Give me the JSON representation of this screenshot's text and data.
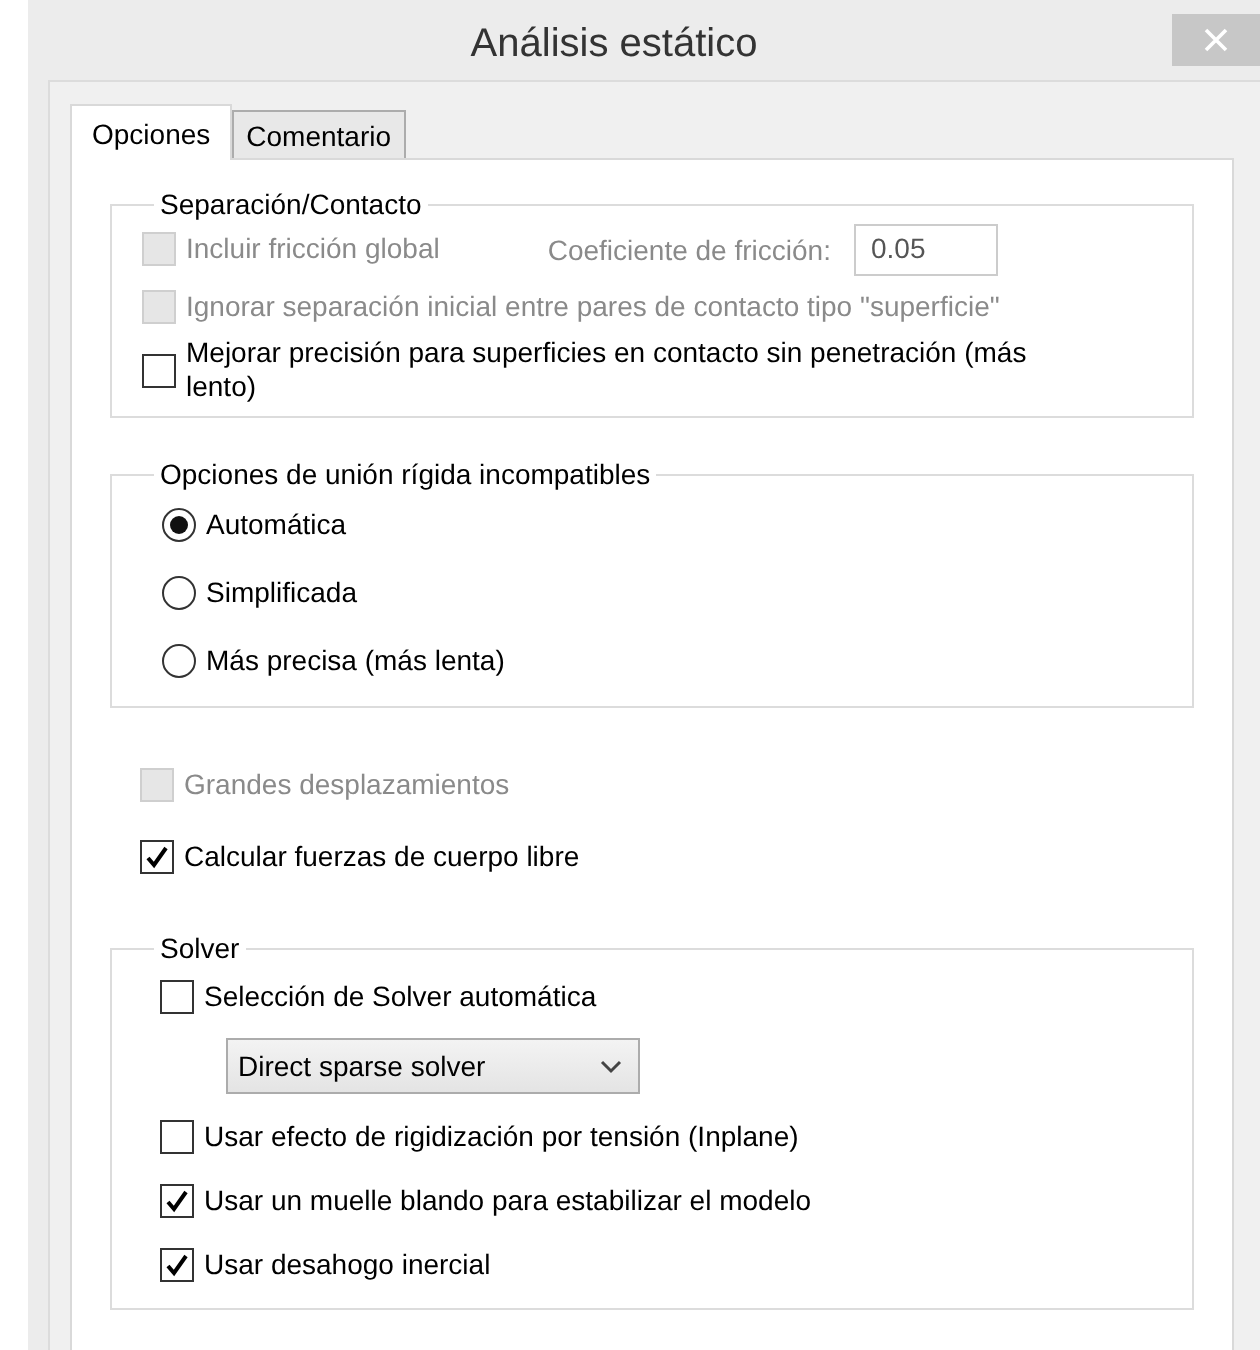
{
  "window": {
    "title": "Análisis estático"
  },
  "tabs": [
    {
      "label": "Opciones",
      "selected": true
    },
    {
      "label": "Comentario",
      "selected": false
    }
  ],
  "sections": [
    {
      "kind": "group",
      "legend": "Separación/Contacto",
      "items": [
        {
          "kind": "checkbox",
          "label": "Incluir fricción global",
          "checked": false,
          "disabled": true,
          "field": {
            "label": "Coeficiente de fricción:",
            "value": "0.05",
            "disabled": true
          }
        },
        {
          "kind": "checkbox",
          "label": "Ignorar separación inicial entre pares de contacto tipo \"superficie\"",
          "checked": false,
          "disabled": true
        },
        {
          "kind": "checkbox",
          "label": "Mejorar precisión para superficies en contacto sin penetración (más lento)",
          "checked": false,
          "disabled": false
        }
      ]
    },
    {
      "kind": "group",
      "legend": "Opciones de unión rígida incompatibles",
      "items": [
        {
          "kind": "radio",
          "label": "Automática",
          "selected": true
        },
        {
          "kind": "radio",
          "label": "Simplificada",
          "selected": false
        },
        {
          "kind": "radio",
          "label": "Más precisa (más lenta)",
          "selected": false
        }
      ]
    },
    {
      "kind": "loose",
      "items": [
        {
          "kind": "checkbox",
          "label": "Grandes desplazamientos",
          "checked": false,
          "disabled": true
        },
        {
          "kind": "checkbox",
          "label": "Calcular fuerzas de cuerpo libre",
          "checked": true,
          "disabled": false
        }
      ]
    },
    {
      "kind": "group",
      "legend": "Solver",
      "items": [
        {
          "kind": "checkbox",
          "label": "Selección de Solver automática",
          "checked": false,
          "disabled": false
        },
        {
          "kind": "dropdown",
          "value": "Direct sparse solver"
        },
        {
          "kind": "checkbox",
          "label": "Usar efecto de rigidización por tensión (Inplane)",
          "checked": false,
          "disabled": false
        },
        {
          "kind": "checkbox",
          "label": "Usar un muelle blando para estabilizar el modelo",
          "checked": true,
          "disabled": false
        },
        {
          "kind": "checkbox",
          "label": "Usar desahogo inercial",
          "checked": true,
          "disabled": false
        }
      ]
    }
  ]
}
